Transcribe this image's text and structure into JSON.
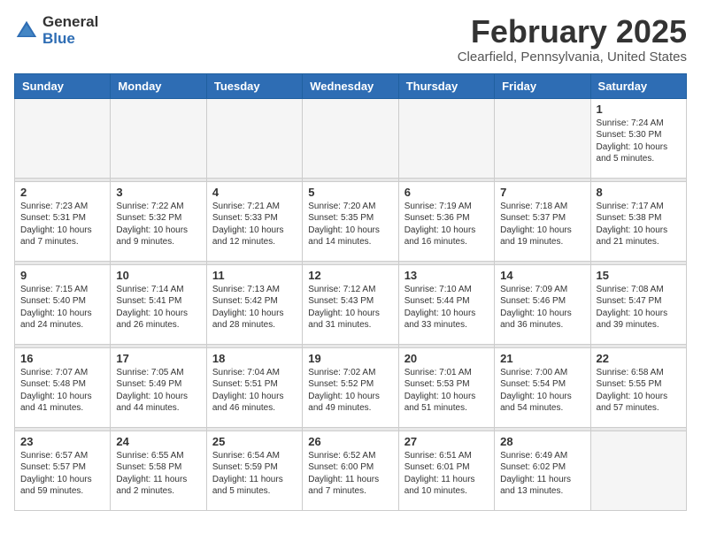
{
  "header": {
    "logo": {
      "general": "General",
      "blue": "Blue"
    },
    "title": "February 2025",
    "location": "Clearfield, Pennsylvania, United States"
  },
  "weekdays": [
    "Sunday",
    "Monday",
    "Tuesday",
    "Wednesday",
    "Thursday",
    "Friday",
    "Saturday"
  ],
  "weeks": [
    [
      {
        "day": "",
        "info": ""
      },
      {
        "day": "",
        "info": ""
      },
      {
        "day": "",
        "info": ""
      },
      {
        "day": "",
        "info": ""
      },
      {
        "day": "",
        "info": ""
      },
      {
        "day": "",
        "info": ""
      },
      {
        "day": "1",
        "info": "Sunrise: 7:24 AM\nSunset: 5:30 PM\nDaylight: 10 hours\nand 5 minutes."
      }
    ],
    [
      {
        "day": "2",
        "info": "Sunrise: 7:23 AM\nSunset: 5:31 PM\nDaylight: 10 hours\nand 7 minutes."
      },
      {
        "day": "3",
        "info": "Sunrise: 7:22 AM\nSunset: 5:32 PM\nDaylight: 10 hours\nand 9 minutes."
      },
      {
        "day": "4",
        "info": "Sunrise: 7:21 AM\nSunset: 5:33 PM\nDaylight: 10 hours\nand 12 minutes."
      },
      {
        "day": "5",
        "info": "Sunrise: 7:20 AM\nSunset: 5:35 PM\nDaylight: 10 hours\nand 14 minutes."
      },
      {
        "day": "6",
        "info": "Sunrise: 7:19 AM\nSunset: 5:36 PM\nDaylight: 10 hours\nand 16 minutes."
      },
      {
        "day": "7",
        "info": "Sunrise: 7:18 AM\nSunset: 5:37 PM\nDaylight: 10 hours\nand 19 minutes."
      },
      {
        "day": "8",
        "info": "Sunrise: 7:17 AM\nSunset: 5:38 PM\nDaylight: 10 hours\nand 21 minutes."
      }
    ],
    [
      {
        "day": "9",
        "info": "Sunrise: 7:15 AM\nSunset: 5:40 PM\nDaylight: 10 hours\nand 24 minutes."
      },
      {
        "day": "10",
        "info": "Sunrise: 7:14 AM\nSunset: 5:41 PM\nDaylight: 10 hours\nand 26 minutes."
      },
      {
        "day": "11",
        "info": "Sunrise: 7:13 AM\nSunset: 5:42 PM\nDaylight: 10 hours\nand 28 minutes."
      },
      {
        "day": "12",
        "info": "Sunrise: 7:12 AM\nSunset: 5:43 PM\nDaylight: 10 hours\nand 31 minutes."
      },
      {
        "day": "13",
        "info": "Sunrise: 7:10 AM\nSunset: 5:44 PM\nDaylight: 10 hours\nand 33 minutes."
      },
      {
        "day": "14",
        "info": "Sunrise: 7:09 AM\nSunset: 5:46 PM\nDaylight: 10 hours\nand 36 minutes."
      },
      {
        "day": "15",
        "info": "Sunrise: 7:08 AM\nSunset: 5:47 PM\nDaylight: 10 hours\nand 39 minutes."
      }
    ],
    [
      {
        "day": "16",
        "info": "Sunrise: 7:07 AM\nSunset: 5:48 PM\nDaylight: 10 hours\nand 41 minutes."
      },
      {
        "day": "17",
        "info": "Sunrise: 7:05 AM\nSunset: 5:49 PM\nDaylight: 10 hours\nand 44 minutes."
      },
      {
        "day": "18",
        "info": "Sunrise: 7:04 AM\nSunset: 5:51 PM\nDaylight: 10 hours\nand 46 minutes."
      },
      {
        "day": "19",
        "info": "Sunrise: 7:02 AM\nSunset: 5:52 PM\nDaylight: 10 hours\nand 49 minutes."
      },
      {
        "day": "20",
        "info": "Sunrise: 7:01 AM\nSunset: 5:53 PM\nDaylight: 10 hours\nand 51 minutes."
      },
      {
        "day": "21",
        "info": "Sunrise: 7:00 AM\nSunset: 5:54 PM\nDaylight: 10 hours\nand 54 minutes."
      },
      {
        "day": "22",
        "info": "Sunrise: 6:58 AM\nSunset: 5:55 PM\nDaylight: 10 hours\nand 57 minutes."
      }
    ],
    [
      {
        "day": "23",
        "info": "Sunrise: 6:57 AM\nSunset: 5:57 PM\nDaylight: 10 hours\nand 59 minutes."
      },
      {
        "day": "24",
        "info": "Sunrise: 6:55 AM\nSunset: 5:58 PM\nDaylight: 11 hours\nand 2 minutes."
      },
      {
        "day": "25",
        "info": "Sunrise: 6:54 AM\nSunset: 5:59 PM\nDaylight: 11 hours\nand 5 minutes."
      },
      {
        "day": "26",
        "info": "Sunrise: 6:52 AM\nSunset: 6:00 PM\nDaylight: 11 hours\nand 7 minutes."
      },
      {
        "day": "27",
        "info": "Sunrise: 6:51 AM\nSunset: 6:01 PM\nDaylight: 11 hours\nand 10 minutes."
      },
      {
        "day": "28",
        "info": "Sunrise: 6:49 AM\nSunset: 6:02 PM\nDaylight: 11 hours\nand 13 minutes."
      },
      {
        "day": "",
        "info": ""
      }
    ]
  ]
}
